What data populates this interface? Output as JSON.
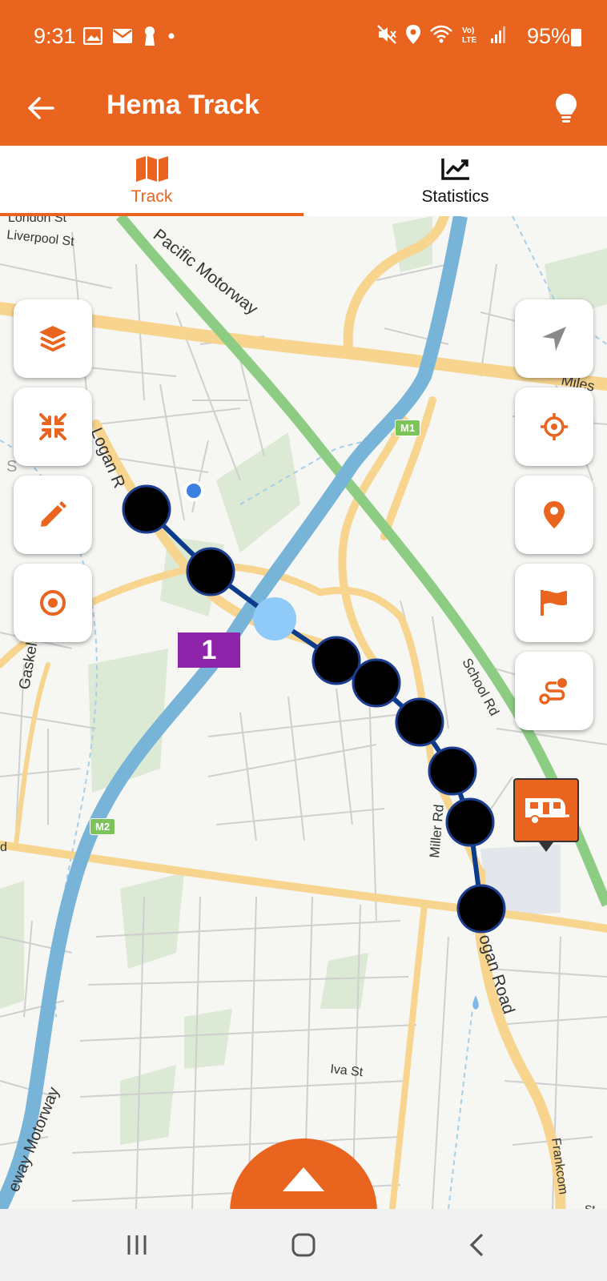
{
  "status_bar": {
    "time": "9:31",
    "battery": "95%",
    "left_icons": [
      "image-icon",
      "mail-icon",
      "keyhole-icon",
      "dot-icon"
    ],
    "right_icons": [
      "mute-icon",
      "location-icon",
      "wifi-icon",
      "volte-icon",
      "signal-icon",
      "battery-icon"
    ]
  },
  "app_bar": {
    "title": "Hema Track",
    "back_icon": "arrow-left-icon",
    "tip_icon": "lightbulb-icon"
  },
  "tabs": [
    {
      "label": "Track",
      "icon": "map-icon",
      "active": true
    },
    {
      "label": "Statistics",
      "icon": "chart-line-icon",
      "active": false
    }
  ],
  "map": {
    "street_labels": {
      "london_st": "London St",
      "liverpool_st": "Liverpool St",
      "pacific_motorway": "Pacific Motorway",
      "logan_rd_north": "Logan R",
      "gaskell_st": "Gaskell St",
      "school_rd": "School Rd",
      "miller_rd": "Miller Rd",
      "logan_road_south": "ogan Road",
      "iva_st": "Iva St",
      "motorway_sw": "eway Motorway",
      "frankcom": "Frankcom",
      "miles": "Miles",
      "st_edge": "St",
      "d_edge": "d",
      "s_edge": "S"
    },
    "shields": {
      "m1": "M1",
      "m2": "M2"
    },
    "waypoint_number": "1",
    "route_color": "#0d3b8c",
    "marker_color": "#000000",
    "current_position_color": "#90caf9"
  },
  "left_controls": [
    {
      "name": "layers-button",
      "icon": "layers-icon"
    },
    {
      "name": "collapse-button",
      "icon": "compress-arrows-icon"
    },
    {
      "name": "edit-button",
      "icon": "pencil-icon"
    },
    {
      "name": "record-button",
      "icon": "target-circle-icon"
    }
  ],
  "right_controls": [
    {
      "name": "navigate-button",
      "icon": "navigation-arrow-icon"
    },
    {
      "name": "locate-button",
      "icon": "crosshair-icon"
    },
    {
      "name": "add-pin-button",
      "icon": "map-pin-icon"
    },
    {
      "name": "flag-button",
      "icon": "flag-icon"
    },
    {
      "name": "route-button",
      "icon": "route-icon"
    }
  ],
  "caravan_marker_icon": "caravan-icon",
  "expand_icon": "chevron-up-icon",
  "nav_bar": {
    "recents_icon": "recents-icon",
    "home_icon": "home-icon",
    "back_icon": "back-chevron-icon"
  },
  "colors": {
    "brand": "#e8641f",
    "route": "#0d3b8c",
    "waypoint_badge": "#8e24aa"
  }
}
